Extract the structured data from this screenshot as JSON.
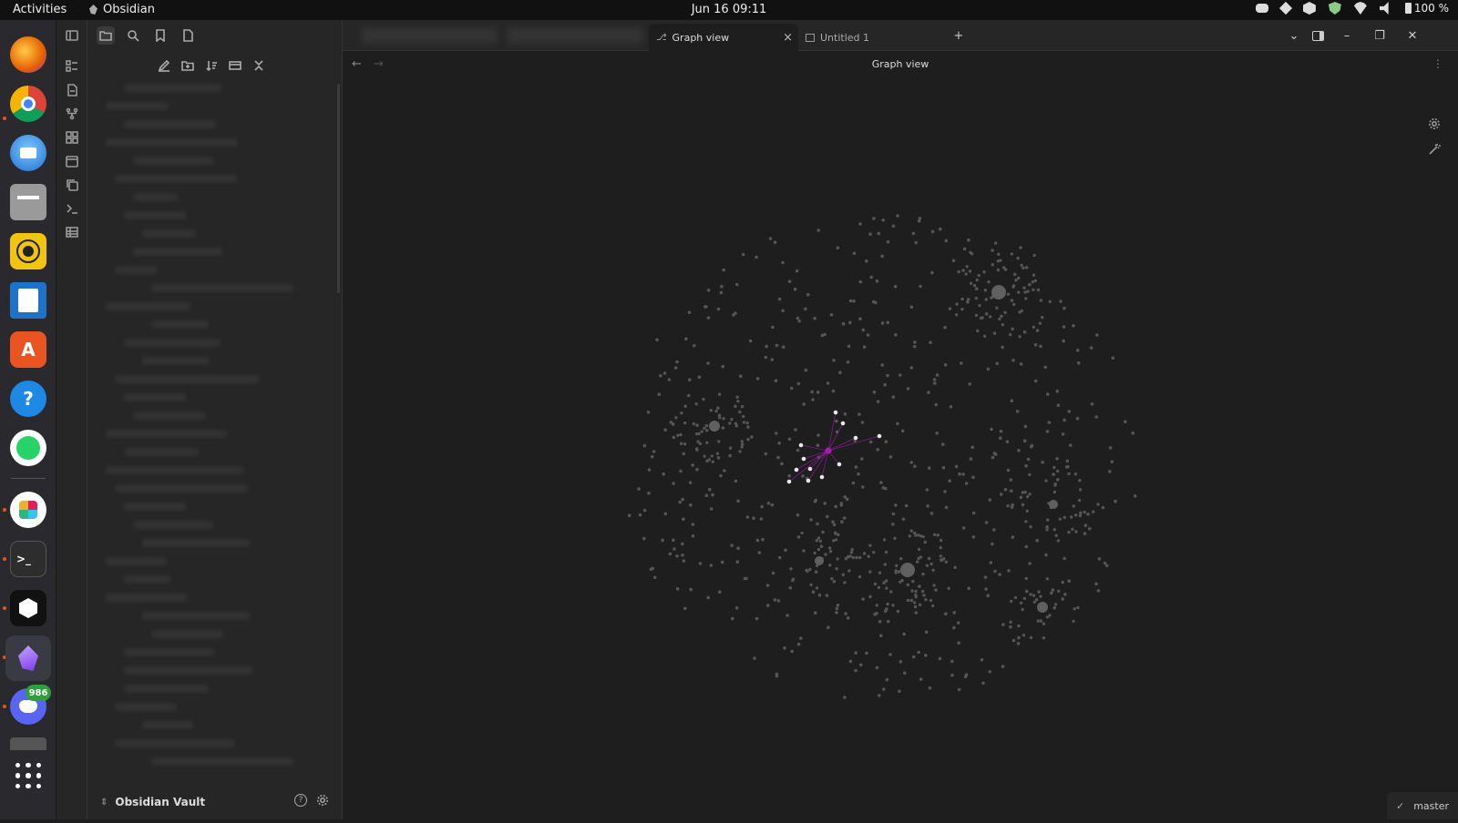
{
  "topbar": {
    "activities": "Activities",
    "app_name": "Obsidian",
    "clock": "Jun 16  09:11",
    "battery": "100 %"
  },
  "dock": {
    "apps": [
      {
        "name": "firefox",
        "icon": "firefox-icon",
        "color": "#e66000"
      },
      {
        "name": "chrome",
        "icon": "chrome-icon",
        "color": "#4285f4"
      },
      {
        "name": "thunderbird",
        "icon": "thunderbird-icon",
        "color": "#1f6fd0"
      },
      {
        "name": "files",
        "icon": "files-icon",
        "color": "#8a8a8a"
      },
      {
        "name": "rhythmbox",
        "icon": "rhythmbox-icon",
        "color": "#e0b400"
      },
      {
        "name": "writer",
        "icon": "writer-icon",
        "color": "#1e73c8"
      },
      {
        "name": "app-center",
        "icon": "app-center-icon",
        "color": "#e95420"
      },
      {
        "name": "help",
        "icon": "help-icon",
        "color": "#1e88e5"
      },
      {
        "name": "whatsapp",
        "icon": "whatsapp-icon",
        "color": "#25d366"
      },
      {
        "name": "slack",
        "icon": "slack-icon",
        "color": "#ffffff"
      },
      {
        "name": "terminal",
        "icon": "terminal-icon",
        "color": "#333333"
      },
      {
        "name": "unity",
        "icon": "unity-icon",
        "color": "#ffffff"
      },
      {
        "name": "obsidian",
        "icon": "obsidian-icon",
        "color": "#7c3aed"
      },
      {
        "name": "discord",
        "icon": "discord-icon",
        "color": "#5865f2"
      },
      {
        "name": "drive",
        "icon": "drive-icon",
        "color": "#555555"
      }
    ],
    "discord_badge": "986"
  },
  "sidebar": {
    "vault_name": "Obsidian Vault"
  },
  "tabs": [
    {
      "label": "Graph view",
      "icon": "graph-icon",
      "active": true
    },
    {
      "label": "Untitled 1",
      "icon": "table-icon",
      "active": false
    }
  ],
  "view": {
    "title": "Graph view"
  },
  "statusbar": {
    "branch": "master"
  },
  "graph_colors": {
    "node": "#555555",
    "highlight": "#e8e8e8",
    "accent": "#a21caf"
  }
}
